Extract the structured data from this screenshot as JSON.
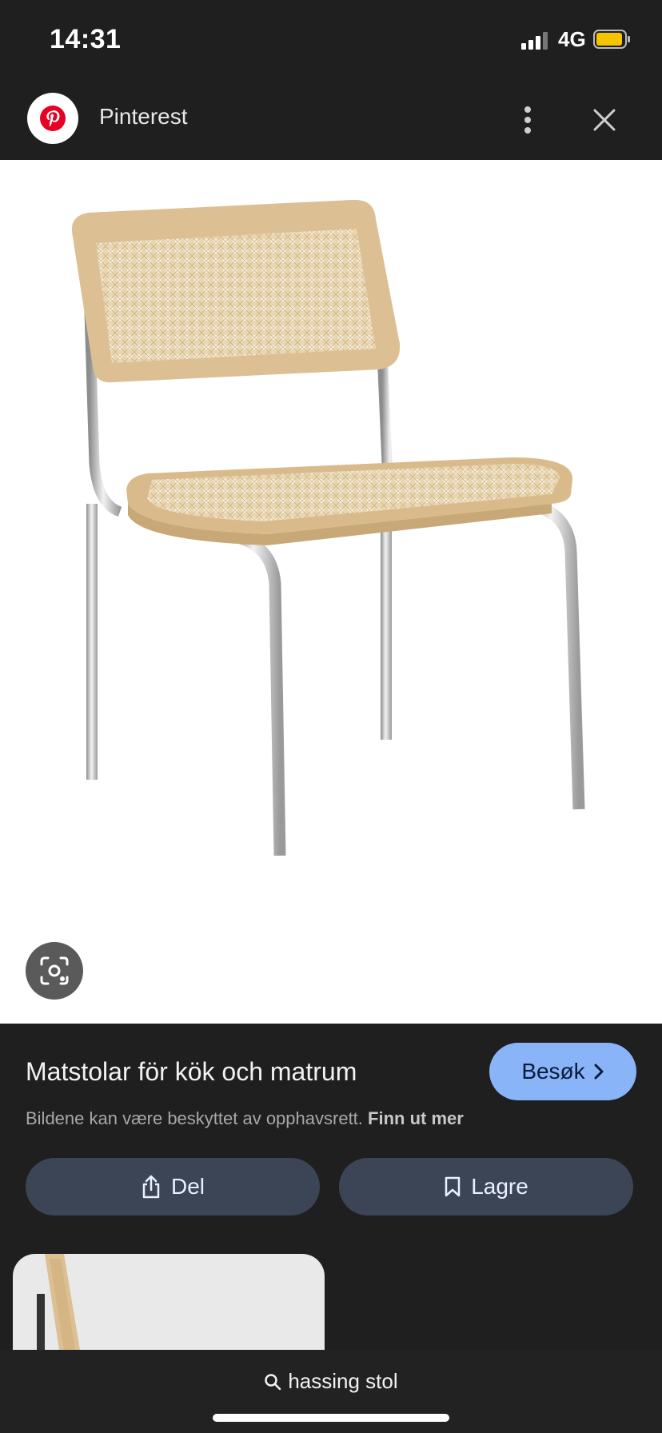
{
  "status_bar": {
    "time": "14:31",
    "network": "4G"
  },
  "header": {
    "site_name": "Pinterest"
  },
  "result": {
    "title": "Matstolar för kök och matrum",
    "visit_label": "Besøk",
    "copyright_text": "Bildene kan være beskyttet av opphavsrett.",
    "copyright_link": "Finn ut mer",
    "share_label": "Del",
    "save_label": "Lagre"
  },
  "bottom": {
    "search_query": "hassing stol"
  },
  "colors": {
    "pinterest_red": "#e60023",
    "visit_button": "#8ab4f8",
    "action_button": "#3c4556",
    "battery": "#f5c400"
  },
  "icons": [
    "signal-icon",
    "battery-icon",
    "pinterest-logo-icon",
    "more-vert-icon",
    "close-icon",
    "lens-icon",
    "chevron-right-icon",
    "share-icon",
    "bookmark-icon",
    "search-icon"
  ]
}
